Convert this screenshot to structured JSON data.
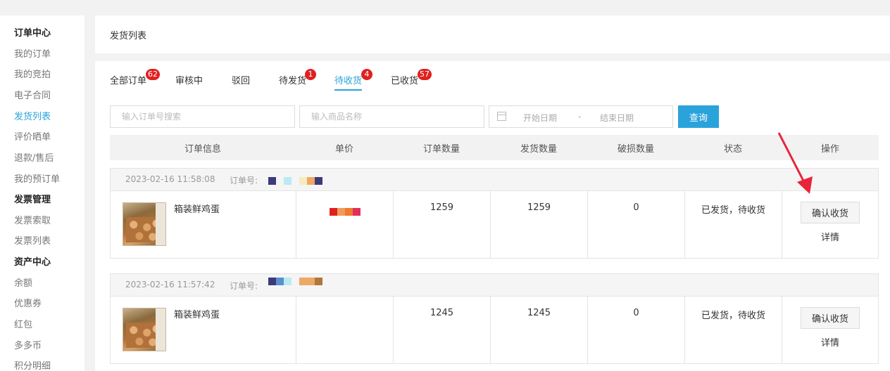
{
  "sidebar": {
    "items": [
      {
        "label": "订单中心",
        "type": "head"
      },
      {
        "label": "我的订单",
        "type": "item"
      },
      {
        "label": "我的竞拍",
        "type": "item"
      },
      {
        "label": "电子合同",
        "type": "item"
      },
      {
        "label": "发货列表",
        "type": "active"
      },
      {
        "label": "评价晒单",
        "type": "item"
      },
      {
        "label": "退款/售后",
        "type": "item"
      },
      {
        "label": "我的预订单",
        "type": "item"
      },
      {
        "label": "发票管理",
        "type": "head"
      },
      {
        "label": "发票索取",
        "type": "item"
      },
      {
        "label": "发票列表",
        "type": "item"
      },
      {
        "label": "资产中心",
        "type": "head"
      },
      {
        "label": "余额",
        "type": "item"
      },
      {
        "label": "优惠券",
        "type": "item"
      },
      {
        "label": "红包",
        "type": "item"
      },
      {
        "label": "多多币",
        "type": "item"
      },
      {
        "label": "积分明细",
        "type": "item"
      }
    ]
  },
  "page_title": "发货列表",
  "tabs": [
    {
      "label": "全部订单",
      "badge": "62"
    },
    {
      "label": "审核中",
      "badge": ""
    },
    {
      "label": "驳回",
      "badge": ""
    },
    {
      "label": "待发货",
      "badge": "1"
    },
    {
      "label": "待收货",
      "badge": "4",
      "active": true
    },
    {
      "label": "已收货",
      "badge": "57"
    }
  ],
  "search": {
    "order_placeholder": "输入订单号搜索",
    "product_placeholder": "输入商品名称",
    "start_date": "开始日期",
    "separator": "-",
    "end_date": "结束日期",
    "button": "查询"
  },
  "table_headers": [
    "订单信息",
    "单价",
    "订单数量",
    "发货数量",
    "破损数量",
    "状态",
    "操作"
  ],
  "orders": [
    {
      "time": "2023-02-16 11:58:08",
      "order_no_label": "订单号:",
      "product": "箱装鲜鸡蛋",
      "order_qty": "1259",
      "ship_qty": "1259",
      "damaged_qty": "0",
      "status": "已发货，待收货",
      "confirm": "确认收货",
      "detail": "详情"
    },
    {
      "time": "2023-02-16 11:57:42",
      "order_no_label": "订单号:",
      "product": "箱装鲜鸡蛋",
      "order_qty": "1245",
      "ship_qty": "1245",
      "damaged_qty": "0",
      "status": "已发货，待收货",
      "confirm": "确认收货",
      "detail": "详情"
    }
  ],
  "colors": {
    "accent": "#2aa3db",
    "badge": "#e02020",
    "arrow": "#e8243a"
  }
}
